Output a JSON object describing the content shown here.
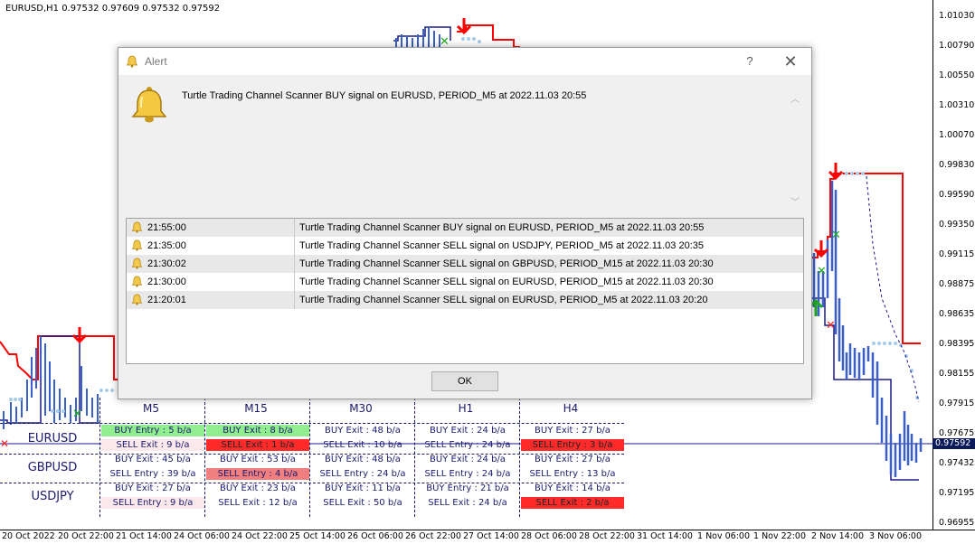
{
  "chart": {
    "symbol_header": "EURUSD,H1  0.97532 0.97609 0.97532 0.97592",
    "price_ticks": [
      "1.01030",
      "1.00790",
      "1.00550",
      "1.00310",
      "1.00070",
      "0.99830",
      "0.99590",
      "0.99350",
      "0.99115",
      "0.98875",
      "0.98635",
      "0.98395",
      "0.98155",
      "0.97915",
      "0.97675",
      "0.97432",
      "0.97195",
      "0.96955"
    ],
    "current_price": "0.97592",
    "time_ticks": [
      "20 Oct 2022",
      "20 Oct 22:00",
      "21 Oct 14:00",
      "24 Oct 06:00",
      "24 Oct 22:00",
      "25 Oct 14:00",
      "26 Oct 06:00",
      "26 Oct 22:00",
      "27 Oct 14:00",
      "28 Oct 06:00",
      "28 Oct 22:00",
      "31 Oct 14:00",
      "1 Nov 06:00",
      "1 Nov 22:00",
      "2 Nov 14:00",
      "3 Nov 06:00"
    ],
    "colors": {
      "upper_channel": "#ff0000",
      "lower_channel": "#1a1a8c",
      "candles": "#3a5fc8",
      "dots": "#a8cce8",
      "signal_up": "#22aa22",
      "signal_down": "#ff0000"
    }
  },
  "scanner": {
    "timeframes": [
      "M5",
      "M15",
      "M30",
      "H1",
      "H4"
    ],
    "symbols": [
      "EURUSD",
      "GBPUSD",
      "USDJPY"
    ],
    "rows": [
      [
        [
          {
            "text": "BUY Entry : 5 b/a",
            "style": "buy-strong"
          },
          {
            "text": "SELL Exit : 9 b/a",
            "style": "faint"
          }
        ],
        [
          {
            "text": "BUY Exit : 8 b/a",
            "style": "buy-strong"
          },
          {
            "text": "SELL Exit : 1 b/a",
            "style": "sell-strong"
          }
        ],
        [
          {
            "text": "BUY Exit : 48 b/a",
            "style": ""
          },
          {
            "text": "SELL Exit : 10 b/a",
            "style": ""
          }
        ],
        [
          {
            "text": "BUY Exit : 24 b/a",
            "style": ""
          },
          {
            "text": "SELL Entry : 24 b/a",
            "style": ""
          }
        ],
        [
          {
            "text": "BUY Exit : 27 b/a",
            "style": ""
          },
          {
            "text": "SELL Entry : 3 b/a",
            "style": "sell-strong"
          }
        ]
      ],
      [
        [
          {
            "text": "BUY Exit : 45 b/a",
            "style": ""
          },
          {
            "text": "SELL Entry : 39 b/a",
            "style": ""
          }
        ],
        [
          {
            "text": "BUY Exit : 53 b/a",
            "style": ""
          },
          {
            "text": "SELL Entry : 4 b/a",
            "style": "sell-mid"
          }
        ],
        [
          {
            "text": "BUY Exit : 48 b/a",
            "style": ""
          },
          {
            "text": "SELL Entry : 24 b/a",
            "style": ""
          }
        ],
        [
          {
            "text": "BUY Exit : 24 b/a",
            "style": ""
          },
          {
            "text": "SELL Entry : 24 b/a",
            "style": ""
          }
        ],
        [
          {
            "text": "BUY Exit : 27 b/a",
            "style": ""
          },
          {
            "text": "SELL Entry : 13 b/a",
            "style": ""
          }
        ]
      ],
      [
        [
          {
            "text": "BUY Exit : 27 b/a",
            "style": ""
          },
          {
            "text": "SELL Entry : 9 b/a",
            "style": "faint"
          }
        ],
        [
          {
            "text": "BUY Exit : 23 b/a",
            "style": ""
          },
          {
            "text": "SELL Exit : 12 b/a",
            "style": ""
          }
        ],
        [
          {
            "text": "BUY Exit : 11 b/a",
            "style": ""
          },
          {
            "text": "SELL Exit : 50 b/a",
            "style": ""
          }
        ],
        [
          {
            "text": "BUY Entry : 21 b/a",
            "style": ""
          },
          {
            "text": "SELL Exit : 24 b/a",
            "style": ""
          }
        ],
        [
          {
            "text": "BUY Exit : 14 b/a",
            "style": ""
          },
          {
            "text": "SELL Exit : 2 b/a",
            "style": "sell-strong"
          }
        ]
      ]
    ]
  },
  "dialog": {
    "title": "Alert",
    "help_label": "?",
    "close_label": "✕",
    "message": "Turtle Trading Channel Scanner BUY signal on EURUSD, PERIOD_M5 at 2022.11.03 20:55",
    "history": [
      {
        "time": "21:55:00",
        "message": "Turtle Trading Channel Scanner BUY signal on EURUSD, PERIOD_M5 at 2022.11.03 20:55"
      },
      {
        "time": "21:35:00",
        "message": "Turtle Trading Channel Scanner SELL signal on USDJPY, PERIOD_M5 at 2022.11.03 20:35"
      },
      {
        "time": "21:30:02",
        "message": "Turtle Trading Channel Scanner SELL signal on GBPUSD, PERIOD_M15 at 2022.11.03 20:30"
      },
      {
        "time": "21:30:00",
        "message": "Turtle Trading Channel Scanner SELL signal on EURUSD, PERIOD_M15 at 2022.11.03 20:30"
      },
      {
        "time": "21:20:01",
        "message": "Turtle Trading Channel Scanner SELL signal on EURUSD, PERIOD_M5 at 2022.11.03 20:20"
      }
    ],
    "ok_label": "OK"
  }
}
